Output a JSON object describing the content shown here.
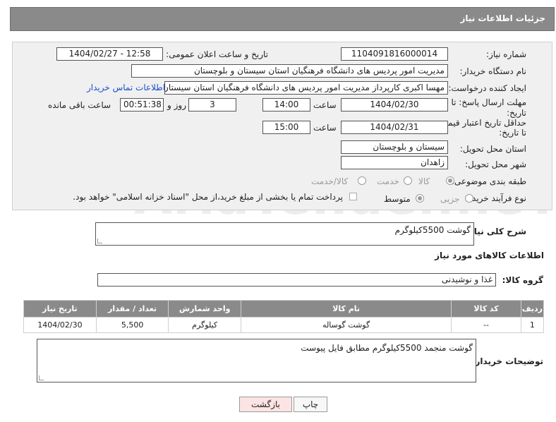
{
  "header": {
    "title": "جزئیات اطلاعات نیاز"
  },
  "form": {
    "need_number": {
      "label": "شماره نیاز:",
      "value": "1104091816000014"
    },
    "announce_datetime": {
      "label": "تاریخ و ساعت اعلان عمومی:",
      "value": "1404/02/27 - 12:58"
    },
    "buyer_org": {
      "label": "نام دستگاه خریدار:",
      "value": "مدیریت امور پردیس های دانشگاه فرهنگیان استان سیستان و بلوچستان"
    },
    "requester": {
      "label": "ایجاد کننده درخواست:",
      "value": "مهسا اکبری کارپرداز مدیریت امور پردیس های دانشگاه فرهنگیان استان سیستان",
      "link": "اطلاعات تماس خریدار"
    },
    "reply_deadline": {
      "label_line1": "مهلت ارسال پاسخ: تا",
      "label_line2": "تاریخ:",
      "date": "1404/02/30",
      "time_label": "ساعت",
      "time": "14:00",
      "days": "3",
      "days_label": "روز و",
      "remaining": "00:51:38",
      "remaining_label": "ساعت باقی مانده"
    },
    "price_validity": {
      "label_line1": "حداقل تاریخ اعتبار قیمت:",
      "label_line2": "تا تاریخ:",
      "date": "1404/02/31",
      "time_label": "ساعت",
      "time": "15:00"
    },
    "delivery_province": {
      "label": "استان محل تحویل:",
      "value": "سیستان و بلوچستان"
    },
    "delivery_city": {
      "label": "شهر محل تحویل:",
      "value": "زاهدان"
    },
    "category": {
      "label": "طبقه بندی موضوعی:",
      "options": [
        "کالا",
        "خدمت",
        "کالا/خدمت"
      ],
      "selected": "کالا"
    },
    "purchase_type": {
      "label": "نوع فرآیند خرید :",
      "options": [
        "جزیی",
        "متوسط"
      ],
      "payment_note": "پرداخت تمام یا بخشی از مبلغ خرید،از محل \"اسناد خزانه اسلامی\" خواهد بود."
    }
  },
  "description": {
    "label": "شرح کلی نیاز:",
    "value": "گوشت 5500کیلوگرم"
  },
  "goods_section": {
    "title": "اطلاعات کالاهای مورد نیاز"
  },
  "goods_group": {
    "label": "گروه کالا:",
    "value": "غذا و نوشیدنی"
  },
  "table": {
    "headers": [
      "ردیف",
      "کد کالا",
      "نام کالا",
      "واحد شمارش",
      "تعداد / مقدار",
      "تاریخ نیاز"
    ],
    "rows": [
      [
        "1",
        "--",
        "گوشت گوساله",
        "کیلوگرم",
        "5,500",
        "1404/02/30"
      ]
    ]
  },
  "buyer_notes": {
    "label": "توضیحات خریدار:",
    "value": "گوشت منجمد 5500کیلوگرم مطابق فایل پیوست"
  },
  "buttons": {
    "print": "چاپ",
    "back": "بازگشت"
  },
  "watermark": {
    "text": "AriaTender.neT"
  }
}
